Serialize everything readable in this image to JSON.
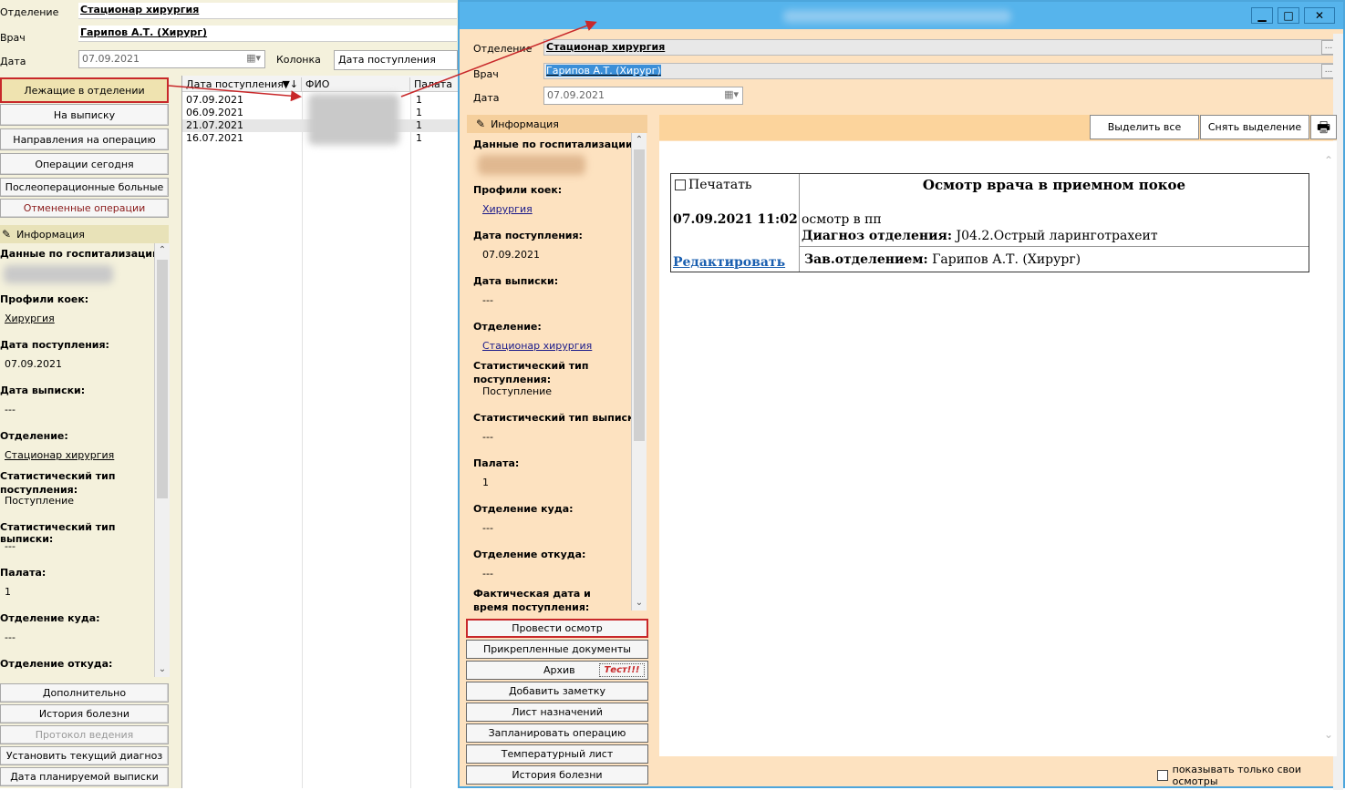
{
  "left": {
    "otdelenie_label": "Отделение",
    "otdelenie_value": "Стационар  хирургия",
    "vrach_label": "Врач",
    "vrach_value": "Гарипов А.Т. (Хирург)",
    "data_label": "Дата",
    "data_value": "07.09.2021",
    "kolonka_label": "Колонка",
    "kolonka_value": "Дата поступления",
    "nav_buttons": [
      "Лежащие в отделении",
      "На выписку",
      "Направления на операцию",
      "Операции сегодня",
      "Послеоперационные больные",
      "Отмененные операции"
    ],
    "info_title": "Информация",
    "info": {
      "hosp_h": "Данные по госпитализации:",
      "profiles_h": "Профили коек:",
      "profiles_v": "Хирургия",
      "admit_h": "Дата поступления:",
      "admit_v": "07.09.2021",
      "disch_h": "Дата выписки:",
      "disch_v": "---",
      "dept_h": "Отделение:",
      "dept_v": "Стационар  хирургия",
      "stat_in_h": "Статистический тип поступления:",
      "stat_in_v": "Поступление",
      "stat_out_h": "Статистический тип выписки:",
      "stat_out_v": "---",
      "ward_h": "Палата:",
      "ward_v": "1",
      "to_h": "Отделение куда:",
      "to_v": "---",
      "from_h": "Отделение откуда:"
    },
    "bottom_buttons": [
      "Дополнительно",
      "История болезни",
      "Протокол ведения",
      "Установить текущий диагноз",
      "Дата планируемой выписки"
    ]
  },
  "grid": {
    "headers": [
      "Дата поступления",
      "ФИО",
      "Палата"
    ],
    "rows": [
      {
        "date": "07.09.2021",
        "ward": "1"
      },
      {
        "date": "06.09.2021",
        "ward": "1"
      },
      {
        "date": "21.07.2021",
        "ward": "1"
      },
      {
        "date": "16.07.2021",
        "ward": "1"
      }
    ]
  },
  "dialog": {
    "otdelenie_label": "Отделение",
    "otdelenie_value": "Стационар  хирургия",
    "vrach_label": "Врач",
    "vrach_value": "Гарипов А.Т. (Хирург)",
    "data_label": "Дата",
    "data_value": "07.09.2021",
    "ellipsis": "...",
    "info_title": "Информация",
    "info": {
      "hosp_h": "Данные по госпитализации:",
      "profiles_h": "Профили коек:",
      "profiles_v": "Хирургия",
      "admit_h": "Дата поступления:",
      "admit_v": "07.09.2021",
      "disch_h": "Дата выписки:",
      "disch_v": "---",
      "dept_h": "Отделение:",
      "dept_v": "Стационар  хирургия",
      "stat_in_h": "Статистический тип поступления:",
      "stat_in_v": "Поступление",
      "stat_out_h": "Статистический тип выписки:",
      "stat_out_v": "---",
      "ward_h": "Палата:",
      "ward_v": "1",
      "to_h": "Отделение куда:",
      "to_v": "---",
      "from_h": "Отделение откуда:",
      "from_v": "---",
      "fact_h": "Фактическая дата и время поступления:"
    },
    "buttons": [
      "Провести осмотр",
      "Прикрепленные документы",
      "Архив",
      "Добавить заметку",
      "Лист назначений",
      "Запланировать операцию",
      "Температурный лист",
      "История болезни"
    ],
    "test_label": "Тест!!!",
    "select_all": "Выделить все",
    "deselect": "Снять выделение",
    "show_own": "показывать только свои осмотры",
    "exam": {
      "print_label": "Печатать",
      "title": "Осмотр врача в приемном покое",
      "datetime": "07.09.2021 11:02",
      "text1": "осмотр в пп",
      "diag_label": "Диагноз отделения:",
      "diag_value": "J04.2.Острый ларинготрахеит",
      "edit_link": "Редактировать",
      "head_label": "Зав.отделением:",
      "head_value": "Гарипов А.Т. (Хирург)"
    }
  },
  "colors": {
    "accent_red": "#c8282a",
    "titlebar": "#56b4ec",
    "dialog_bg": "#fde2c0",
    "left_bg": "#f4f1dc"
  }
}
